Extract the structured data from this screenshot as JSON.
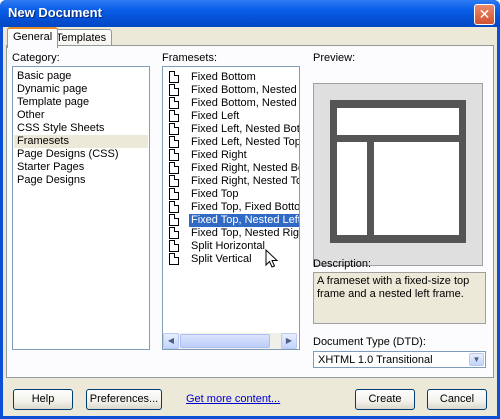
{
  "window": {
    "title": "New Document",
    "close_label": "✕"
  },
  "tabs": [
    {
      "label": "General",
      "active": true
    },
    {
      "label": "Templates",
      "active": false
    }
  ],
  "category": {
    "label": "Category:",
    "items": [
      "Basic page",
      "Dynamic page",
      "Template page",
      "Other",
      "CSS Style Sheets",
      "Framesets",
      "Page Designs (CSS)",
      "Starter Pages",
      "Page Designs"
    ],
    "selected": "Framesets"
  },
  "framesets": {
    "label": "Framesets:",
    "items": [
      "Fixed Bottom",
      "Fixed Bottom, Nested Left",
      "Fixed Bottom, Nested Right",
      "Fixed Left",
      "Fixed Left, Nested Bottom",
      "Fixed Left, Nested Top",
      "Fixed Right",
      "Fixed Right, Nested Bottom",
      "Fixed Right, Nested Top",
      "Fixed Top",
      "Fixed Top, Fixed Bottom",
      "Fixed Top, Nested Left",
      "Fixed Top, Nested Right",
      "Split Horizontal",
      "Split Vertical"
    ],
    "selected": "Fixed Top, Nested Left",
    "scroll_left_icon": "◀",
    "scroll_right_icon": "▶"
  },
  "preview": {
    "label": "Preview:"
  },
  "description": {
    "label": "Description:",
    "text": "A frameset with a fixed-size top frame and a nested left frame."
  },
  "doctype": {
    "label": "Document Type (DTD):",
    "value": "XHTML 1.0 Transitional",
    "arrow_icon": "▼"
  },
  "buttons": {
    "help": "Help",
    "preferences": "Preferences...",
    "get_more": "Get more content...",
    "create": "Create",
    "cancel": "Cancel"
  },
  "colors": {
    "title_bar": "#0a5ee8",
    "selection": "#316ac5",
    "dialog_bg": "#ece9d8"
  }
}
